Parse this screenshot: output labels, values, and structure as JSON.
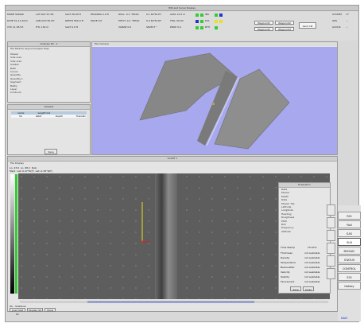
{
  "window": {
    "title": "HMI and Sonar Display"
  },
  "info_panel": {
    "col1": [
      "MODE SONAR",
      "DATE 01.11.2011",
      "UTC 11:05:53"
    ],
    "col2": [
      "LAT 002°47.59'",
      "LON 043°40.50'",
      "HTL 130 m"
    ],
    "col3": [
      "SALT 38.00 ft",
      "DEPTH 800.0 ft",
      "SALT 0.0 ft"
    ],
    "col4": [
      "HEADING 0.0 ft",
      "WAVE 0.0"
    ],
    "col5": [
      "ROLL -0.1 °HEAD",
      "PITCH -0.1 °HEAD",
      "VAMAE 0.0"
    ],
    "col6": [
      "0.1 60°N 05°",
      "0.9 60°N 06°",
      "SELECT °"
    ],
    "col7": [
      "ALTIL 12.0 m",
      "TELL 00:00",
      "PROP 0.0"
    ],
    "flags": [
      "INS",
      "DVL",
      "RTH"
    ],
    "waypoints": [
      "Waypoint1",
      "Waypoint2",
      "Waypoint3",
      "Waypoint4"
    ],
    "send_label": "Send LM",
    "system": [
      "SYSTEM",
      "GPS",
      "ACOUS"
    ],
    "system_vals": [
      "77",
      "- -",
      "- -"
    ]
  },
  "analysis": {
    "title": "Analysis Sit - 1",
    "menu": "File  Module  Layout  Analyse  Help",
    "items": [
      "Mosaic",
      "Side scan",
      "Side scan",
      "Subbot",
      "Bath",
      "Cursor",
      "Quantity",
      "Quantity 1",
      "Segment",
      "Bathy",
      "Layer",
      "Contours"
    ]
  },
  "dataset": {
    "title": "Dataset",
    "headers": [
      "name",
      "weight list"
    ],
    "row": [
      "SS",
      "GRAY",
      "Depth",
      "Transfer"
    ],
    "button": "Save"
  },
  "view3d": {
    "menu": "File  Camera"
  },
  "sidescan": {
    "title": "SLANT 1",
    "menu": "File  Display",
    "header1": [
      "Lo. 43.6",
      "Lo. 08.2",
      "Rain"
    ],
    "header2": [
      "Mark",
      "Lat:-0.47°N(T)",
      "Lat:-0.36°N(T)"
    ],
    "status": "Ok - SideScan",
    "footer_buttons": [
      "Load SLM 01",
      "Display SS",
      "Show"
    ]
  },
  "evaluation": {
    "title": "Evaluation",
    "lines": [
      "Data",
      "Mosaic",
      "Depth",
      "Date",
      "Mosaic Tile",
      "Latitude",
      "Longitude",
      "Heading",
      "Roughness",
      "Pitch",
      "Roll",
      "Frequency",
      "Altitude"
    ],
    "time_label": "Time Stamp",
    "time_value": "15:03:2",
    "rows": [
      [
        "Thickness",
        "not available"
      ],
      [
        "Density",
        "not available"
      ],
      [
        "Temperature",
        "not available"
      ],
      [
        "Backscatter",
        "not available"
      ],
      [
        "Velocity",
        "not available"
      ],
      [
        "Salinity",
        "not available"
      ],
      [
        "Fluorescent",
        "not available"
      ]
    ],
    "buttons": [
      "Save",
      "Close"
    ]
  },
  "right_panel": {
    "items": [
      "ROI",
      "Roll",
      "SAS",
      "SLN",
      "MOSAIC",
      "STATUS",
      "CONTROL",
      "EOI",
      "Hotkey"
    ],
    "active": "SLN",
    "footer": "NAVI"
  },
  "colors": {
    "view3d_bg": "#a8a8ef",
    "seafloor": "#8a8a8a",
    "sonar_bg": "#5c5c5c",
    "accent_green": "#33cc33",
    "accent_blue": "#2233cc",
    "accent_yellow": "#e8e020"
  }
}
